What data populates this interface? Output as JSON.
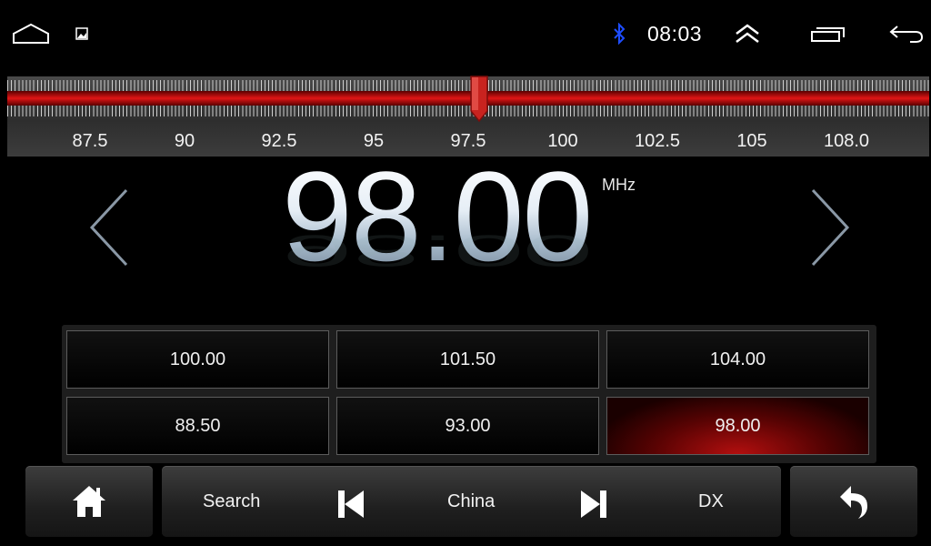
{
  "status_bar": {
    "time": "08:03",
    "icons": [
      "home-outline-icon",
      "image-icon",
      "bluetooth-icon",
      "chevron-up-double-icon",
      "recent-apps-icon",
      "back-icon"
    ],
    "bluetooth_color": "#1e4dff"
  },
  "tuner": {
    "scale_labels": [
      "87.5",
      "90",
      "92.5",
      "95",
      "97.5",
      "100",
      "102.5",
      "105",
      "108.0"
    ],
    "range_mhz": [
      87.5,
      108.0
    ],
    "needle_mhz": 98.0,
    "band_color": "#e01616"
  },
  "display": {
    "frequency": "98.00",
    "unit": "MHz"
  },
  "presets": [
    {
      "label": "100.00",
      "active": false
    },
    {
      "label": "101.50",
      "active": false
    },
    {
      "label": "104.00",
      "active": false
    },
    {
      "label": "88.50",
      "active": false
    },
    {
      "label": "93.00",
      "active": false
    },
    {
      "label": "98.00",
      "active": true
    }
  ],
  "controls": {
    "search": "Search",
    "region": "China",
    "dx": "DX",
    "icons": [
      "home-icon",
      "skip-previous-icon",
      "skip-next-icon",
      "return-icon"
    ]
  }
}
